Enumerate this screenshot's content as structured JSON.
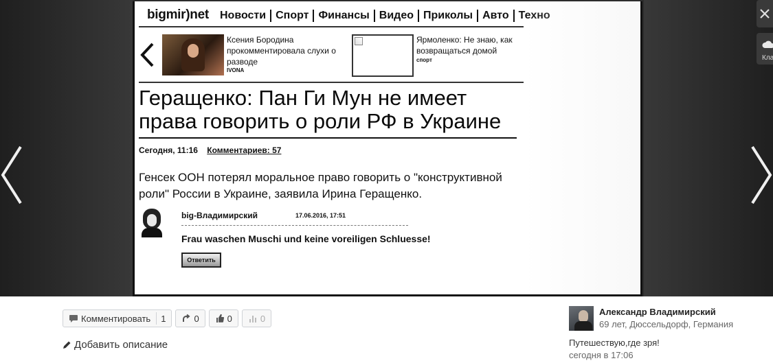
{
  "viewer": {
    "save_label": "Кла"
  },
  "article": {
    "logo": "bigmir)net",
    "nav": [
      "Новости",
      "Спорт",
      "Финансы",
      "Видео",
      "Приколы",
      "Авто",
      "Техно"
    ],
    "related": [
      {
        "title": "Ксения Бородина прокомментировала слухи о разводе",
        "source": "IVONA"
      },
      {
        "title": "Ярмоленко: Не знаю, как возвращаться домой",
        "source": "спорт"
      }
    ],
    "headline": "Геращенко: Пан Ги Мун не имеет права говорить о роли РФ в Украине",
    "time": "Сегодня, 11:16",
    "comments_link": "Комментариев: 57",
    "lead": "Генсек ООН потерял моральное право говорить о \"конструктивной роли\" России в Украине, заявила Ирина Геращенко.",
    "comment": {
      "author": "big-Владимирский",
      "date": "17.06.2016, 17:51",
      "text": "Frau waschen Muschi und keine voreiligen Schluesse!",
      "reply": "Ответить"
    }
  },
  "actions": {
    "comment_label": "Комментировать",
    "comment_count": "1",
    "reshare_count": "0",
    "like_count": "0",
    "stats_count": "0"
  },
  "add_description": "Добавить описание",
  "owner": {
    "name": "Александр Владимирский",
    "info": "69 лет, Дюссельдорф, Германия",
    "status": "Путешествую,где зря!",
    "time": "сегодня в 17:06"
  },
  "colors": {
    "viewer_bg": "#2c2c2c",
    "button_border": "#cfd2d6",
    "text_muted": "#666666"
  },
  "icons": [
    "arrow-left-icon",
    "arrow-right-icon",
    "close-icon",
    "download-icon",
    "comment-icon",
    "reshare-icon",
    "like-icon",
    "stats-icon",
    "pencil-icon"
  ]
}
